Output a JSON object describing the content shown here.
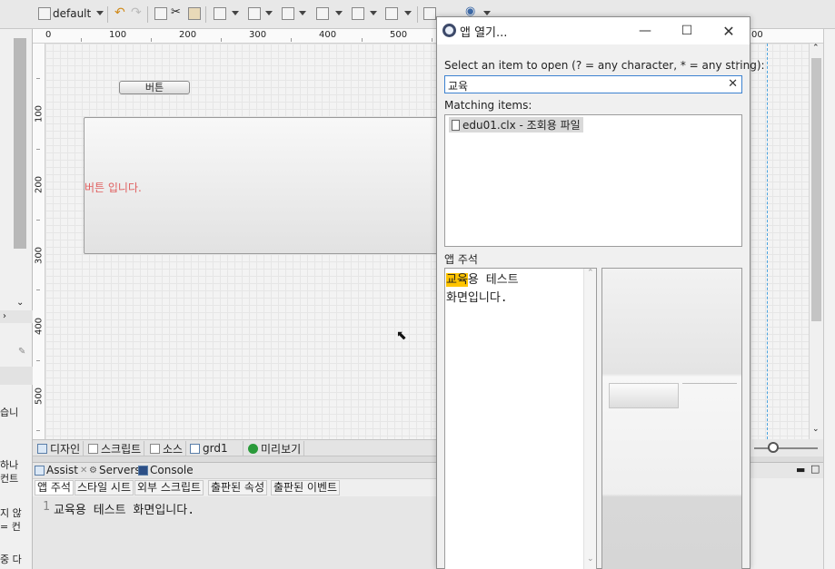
{
  "toolbar": {
    "layout_select": "default",
    "icons": [
      "layout-icon",
      "undo-icon",
      "redo-icon",
      "copy-icon",
      "cut-icon",
      "paste-icon",
      "align-left-icon",
      "align-top-icon",
      "distribute-icon",
      "group-icon",
      "resize-icon",
      "move-icon",
      "camera-icon",
      "globe-icon"
    ]
  },
  "ruler": {
    "h_labels": [
      "0",
      "100",
      "200",
      "300",
      "400",
      "500",
      "00"
    ],
    "v_labels": [
      "100",
      "200",
      "300",
      "400",
      "500"
    ]
  },
  "canvas": {
    "button_label": "버튼",
    "red_text": "버튼 입니다."
  },
  "left_panel_texts": [
    "습니",
    "하나",
    "컨트",
    "지 않",
    "= 컨",
    "중 다"
  ],
  "editor_tabs": [
    "디자인",
    "스크립트",
    "소스",
    "grd1",
    "미리보기"
  ],
  "bottom_panel": {
    "tabs": [
      "Assist",
      "Servers",
      "Console"
    ],
    "subtabs": [
      "앱 주석",
      "스타일 시트",
      "외부 스크립트",
      "출판된 속성",
      "출판된 이벤트"
    ],
    "line_number": "1",
    "line_text": "교육용 테스트 화면입니다."
  },
  "dialog": {
    "title": "앱 열기...",
    "prompt": "Select an item to open (? = any character, * = any string):",
    "search_value": "교육",
    "matching_label": "Matching items:",
    "matching_items": [
      "edu01.clx - 조회용 파일"
    ],
    "comment_label": "앱 주석",
    "comment_highlight": "교육",
    "comment_line1_rest": "용 테스트",
    "comment_line2": "화면입니다."
  }
}
